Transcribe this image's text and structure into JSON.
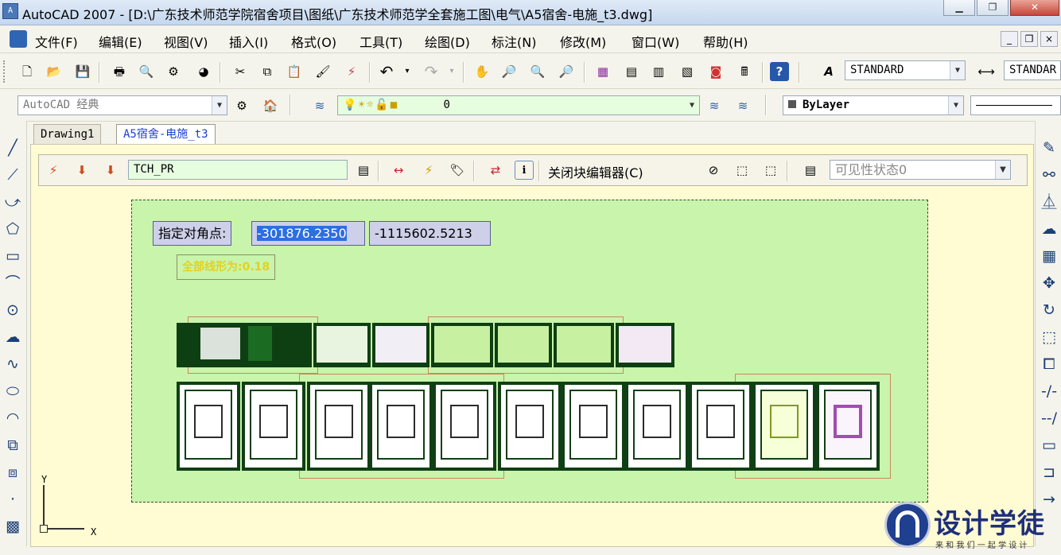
{
  "window": {
    "app_icon": "AutoCAD",
    "title": "AutoCAD 2007 - [D:\\广东技术师范学院宿舍项目\\图纸\\广东技术师范学全套施工图\\电气\\A5宿舍-电施_t3.dwg]",
    "minimize": "▁",
    "restore": "❐",
    "close": "✕"
  },
  "menu": {
    "items": [
      "文件(F)",
      "编辑(E)",
      "视图(V)",
      "插入(I)",
      "格式(O)",
      "工具(T)",
      "绘图(D)",
      "标注(N)",
      "修改(M)",
      "窗口(W)",
      "帮助(H)"
    ],
    "doc_minimize": "_",
    "doc_restore": "❐",
    "doc_close": "×"
  },
  "standard_toolbar": {
    "text_style": "STANDARD",
    "dim_style": "STANDAR"
  },
  "layers_toolbar": {
    "workspace": "AutoCAD 经典",
    "current_layer": "0",
    "color": "ByLayer"
  },
  "tabs": [
    "Drawing1",
    "A5宿舍-电施_t3"
  ],
  "block_editor": {
    "block_name": "TCH_PR",
    "close_label": "关闭块编辑器(C)",
    "visibility_placeholder": "可见性状态0"
  },
  "drawing": {
    "prompt_label": "指定对角点:",
    "coord_x": "-301876.2350",
    "coord_y": "-1115602.5213",
    "status_text": "全部线形为:0.18"
  },
  "ucs": {
    "x_label": "X",
    "y_label": "Y"
  },
  "watermark": {
    "brand": "设计学徒",
    "slogan": "来 和 我 们 一 起 学 设 计"
  },
  "colors": {
    "selection_fill": "#c8f4ac",
    "canvas_bg": "#fffbd2",
    "sheet_border": "#113f15",
    "tab_active": "#1a3fd0"
  }
}
